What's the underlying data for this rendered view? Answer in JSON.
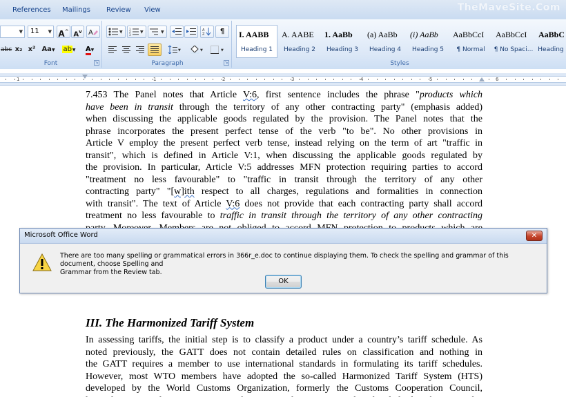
{
  "ribbon": {
    "tabs": [
      "References",
      "Mailings",
      "Review",
      "View"
    ],
    "watermark": "TheMaveSite.Com",
    "font_group": {
      "label": "Font",
      "font_size": "11",
      "grow_font": "A",
      "shrink_font": "A",
      "strikethrough": "abc",
      "subscript": "x₂",
      "superscript": "x²",
      "change_case": "Aa",
      "highlight": "ab",
      "font_color": "A"
    },
    "paragraph_group": {
      "label": "Paragraph",
      "show_hide": "¶"
    },
    "styles_group": {
      "label": "Styles",
      "styles": [
        {
          "sample": "I. AABB",
          "name": "Heading 1"
        },
        {
          "sample": "A. AABE",
          "name": "Heading 2"
        },
        {
          "sample": "1. AaBb",
          "name": "Heading 3"
        },
        {
          "sample": "(a) AaBb",
          "name": "Heading 4"
        },
        {
          "sample": "(i) AaBb",
          "name": "Heading 5"
        },
        {
          "sample": "AaBbCcI",
          "name": "¶ Normal"
        },
        {
          "sample": "AaBbCcI",
          "name": "¶ No Spaci..."
        },
        {
          "sample": "AaBbCc",
          "name": "Heading"
        }
      ]
    }
  },
  "ruler": {
    "numbers": [
      "1",
      "1",
      "2",
      "3",
      "4",
      "5",
      "6"
    ]
  },
  "document": {
    "paragraph_lines": [
      [
        {
          "t": "7.453    The Panel notes that Article "
        },
        {
          "t": "V:6",
          "sq": true
        },
        {
          "t": ", first sentence includes the phrase \""
        },
        {
          "t": "products which",
          "it": true
        }
      ],
      [
        {
          "t": "have been in transit",
          "it": true
        },
        {
          "t": " through the territory of any other contracting party\" (emphasis added)"
        }
      ],
      [
        {
          "t": "when discussing the applicable goods regulated by the provision. The Panel notes that the"
        }
      ],
      [
        {
          "t": "phrase incorporates the present perfect tense of the verb \"to be\". No other provisions in"
        }
      ],
      [
        {
          "t": "Article V employ the present perfect verb tense, instead relying on the term of art \"traffic in"
        }
      ],
      [
        {
          "t": "transit\", which is defined in Article V:1, when discussing the applicable goods regulated by"
        }
      ],
      [
        {
          "t": "the provision. In particular, Article V:5 addresses MFN protection requiring parties to accord"
        }
      ],
      [
        {
          "t": "\"treatment no less favourable\" to \"traffic in transit through the territory of any other"
        }
      ],
      [
        {
          "t": "contracting party\" \"["
        },
        {
          "t": "w]ith",
          "sq": true
        },
        {
          "t": " respect to all charges, regulations and formalities in connection"
        }
      ],
      [
        {
          "t": "with transit\". The text of Article "
        },
        {
          "t": "V:6",
          "sq": true
        },
        {
          "t": " does not provide that each contracting party shall accord"
        }
      ],
      [
        {
          "t": "treatment no less favourable to "
        },
        {
          "t": "traffic in transit through the territory of any other contracting",
          "it": true
        }
      ],
      [
        {
          "t": "party. Moreover, Members are not obliged to accord MFN protection to products which are"
        }
      ]
    ],
    "heading": "III.  The Harmonized Tariff System",
    "section_lines": [
      [
        {
          "t": "In assessing tariffs, the initial step is to classify a product under a country’s tariff schedule. As"
        }
      ],
      [
        {
          "t": "noted previously, the GATT does not contain detailed rules on classification and nothing in"
        }
      ],
      [
        {
          "t": "the GATT requires a member to use international standards in formulating its tariff schedules."
        }
      ],
      [
        {
          "t": "However, most WTO members have adopted the so-called Harmonized Tariff System (HTS)"
        }
      ],
      [
        {
          "t": "developed by the World Customs Organization, formerly the Customs Cooperation Council,"
        }
      ],
      [
        {
          "t": "located in Brussels. In contrast to the GATT, the HTS provides detailed classification rules"
        }
      ]
    ]
  },
  "dialog": {
    "title": "Microsoft Office Word",
    "close_glyph": "✕",
    "message": "There are too many spelling or grammatical errors in 366r_e.doc to continue displaying them. To check the spelling and grammar of this document, choose Spelling and\nGrammar from the Review tab.",
    "ok_label": "OK"
  },
  "colors": {
    "warning_fill": "#f7d443",
    "close_button": "#c4442b",
    "squiggle": "#3c72c7"
  }
}
